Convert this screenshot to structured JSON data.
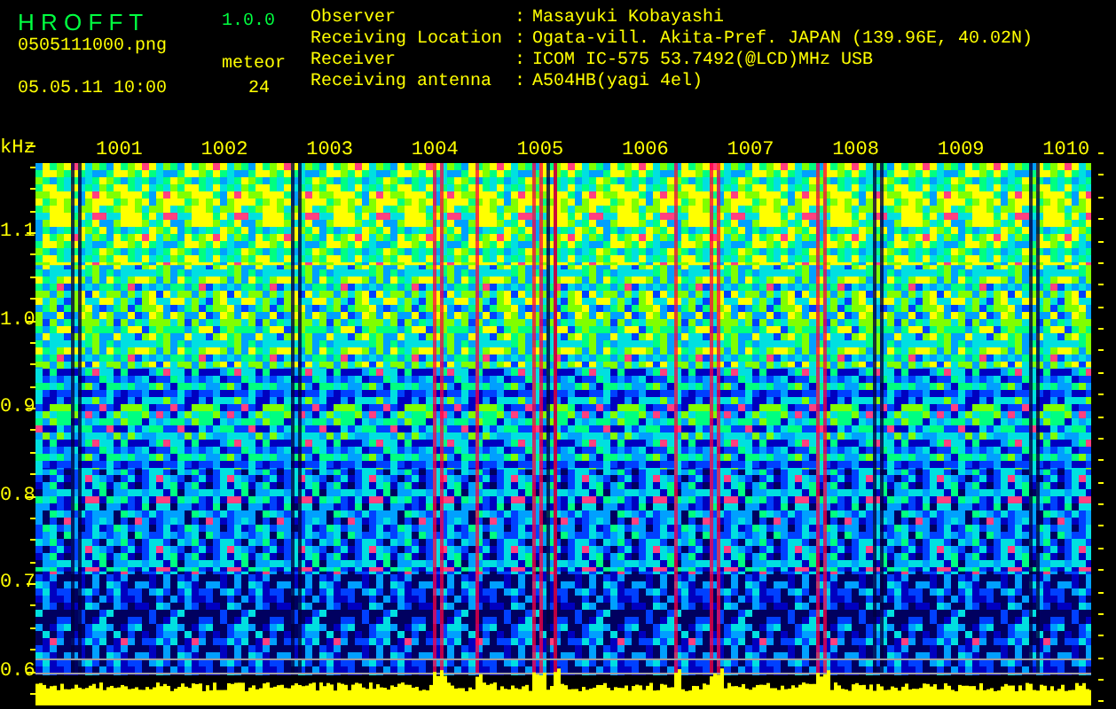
{
  "app": {
    "name": "H R O F F T",
    "version": "1.0.0"
  },
  "file": "0505111000.png",
  "datetime": "05.05.11 10:00",
  "meteor": {
    "label": "meteor",
    "count": "24"
  },
  "station_info": [
    {
      "label": "Observer",
      "separator": ":",
      "value": "Masayuki Kobayashi"
    },
    {
      "label": "Receiving Location",
      "separator": ":",
      "value": "Ogata-vill. Akita-Pref. JAPAN (139.96E, 40.02N)"
    },
    {
      "label": "Receiver",
      "separator": ":",
      "value": "ICOM IC-575 53.7492(@LCD)MHz USB"
    },
    {
      "label": "Receiving antenna",
      "separator": ":",
      "value": "A504HB(yagi 4el)"
    }
  ],
  "spectrogram": {
    "unit": "kHz",
    "frequency_labels": [
      "1.1",
      "1.0",
      "0.9",
      "0.8",
      "0.7",
      "0.6"
    ],
    "minute_labels": [
      "1001",
      "1002",
      "1003",
      "1004",
      "1005",
      "1006",
      "1007",
      "1008",
      "1009",
      "1010"
    ]
  }
}
